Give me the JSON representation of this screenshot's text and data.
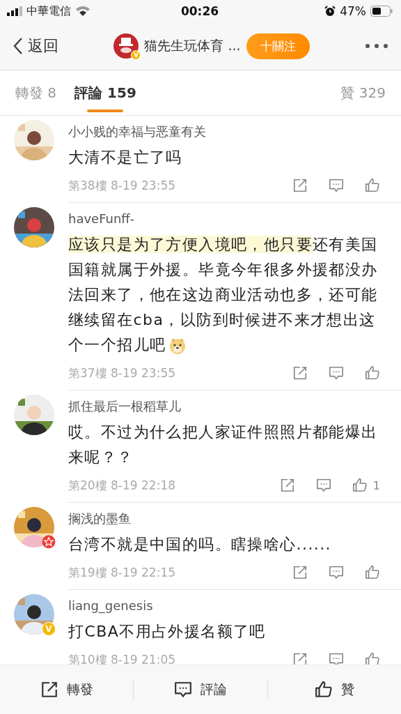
{
  "status_bar": {
    "carrier": "中華電信",
    "time": "00:26",
    "battery": "47%"
  },
  "nav": {
    "back": "返回",
    "title": "猫先生玩体育 ...",
    "avatar_badge": {
      "kind": "verified",
      "text": "V"
    },
    "follow": "十關注"
  },
  "tabs": [
    {
      "label": "轉發 8",
      "selected": false
    },
    {
      "label": "評論 159",
      "selected": true
    },
    {
      "label": "贊 329",
      "selected": false
    }
  ],
  "comments": [
    {
      "name": "小小贱的幸福与恶童有关",
      "body": "大清不是亡了吗",
      "meta": "第38樓 8-19 23:55"
    },
    {
      "name": "haveFunff-",
      "body_highlight": "应该只是为了方便入境吧，他只要",
      "body": "还有美国国籍就属于外援。毕竟今年很多外援都没办法回来了，他在这边商业活动也多，还可能继续留在cba，以防到时候进不来才想出这个一个招儿吧",
      "emoji": true,
      "meta": "第37樓 8-19 23:55"
    },
    {
      "name": "抓住最后一根稻草儿",
      "body": "哎。不过为什么把人家证件照照片都能爆出来呢？？",
      "meta": "第20樓 8-19 22:18",
      "likes": "1"
    },
    {
      "name": "搁浅的墨鱼",
      "badge": {
        "kind": "star"
      },
      "body": "台湾不就是中国的吗。瞎操啥心......",
      "meta": "第19樓 8-19 22:15"
    },
    {
      "name": "liang_genesis",
      "badge": {
        "kind": "verified",
        "text": "V"
      },
      "body": "打CBA不用占外援名额了吧",
      "meta": "第10樓 8-19 21:05"
    }
  ],
  "bottom_bar": [
    {
      "kind": "repost",
      "label": "轉發"
    },
    {
      "kind": "comment",
      "label": "評論"
    },
    {
      "kind": "like",
      "label": "贊"
    }
  ]
}
